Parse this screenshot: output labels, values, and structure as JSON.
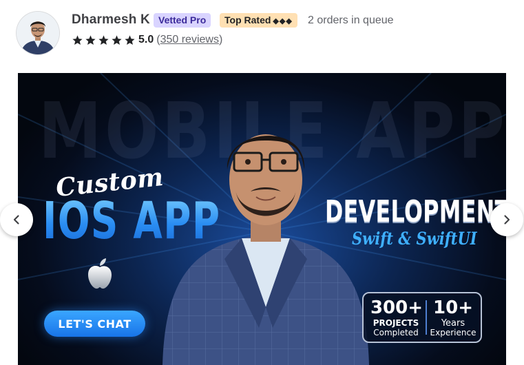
{
  "seller": {
    "name": "Dharmesh K",
    "badges": {
      "vetted": "Vetted Pro",
      "top_rated": "Top Rated",
      "top_rated_diamonds": "◆◆◆"
    },
    "queue": "2 orders in queue",
    "rating": {
      "stars": 5,
      "value": "5.0",
      "reviews_open": "(",
      "reviews_link": "350 reviews",
      "reviews_close": ")"
    },
    "avatar_icon": "person-avatar"
  },
  "gallery": {
    "image": {
      "background_word": "MOBILE APP",
      "custom": "Custom",
      "headline": "IOS APP",
      "development": "DEVELOPMENT",
      "tagline": "Swift & SwiftUI",
      "cta": "LET'S CHAT",
      "stats": {
        "a_number": "300+",
        "a_line1": "PROJECTS",
        "a_line2": "Completed",
        "b_number": "10+",
        "b_line1": "Years",
        "b_line2": "Experience"
      }
    },
    "prev_icon": "chevron-left-icon",
    "next_icon": "chevron-right-icon"
  },
  "colors": {
    "accent_blue": "#2a8df2",
    "vetted_badge_bg": "#d9d4ff",
    "top_rated_badge_bg": "#ffe0b3",
    "star": "#222325"
  }
}
